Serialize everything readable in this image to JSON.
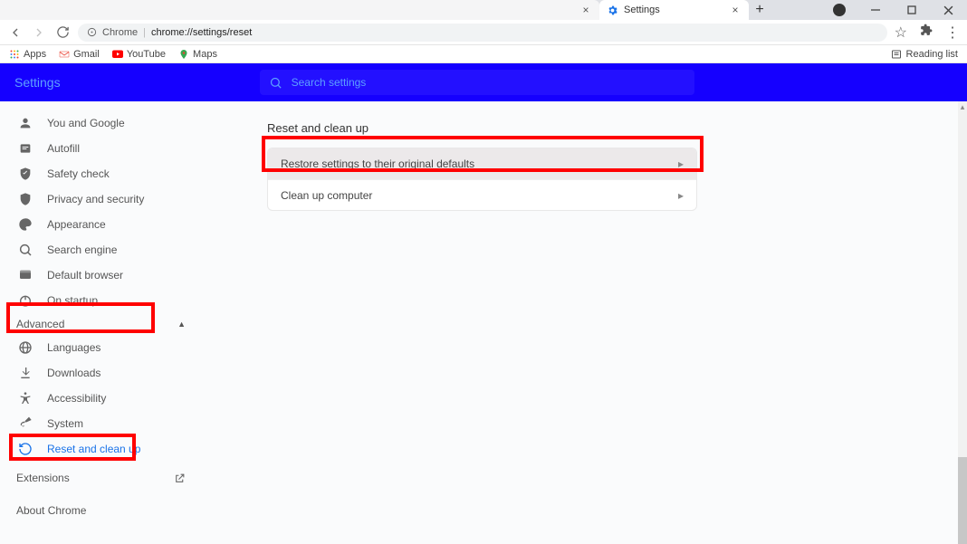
{
  "tabs": {
    "blank": {
      "close": "×"
    },
    "settings": {
      "label": "Settings",
      "close": "×"
    },
    "new": "+"
  },
  "toolbar": {
    "chrome_label": "Chrome",
    "addr_path": "chrome://settings/reset"
  },
  "bookmarks": {
    "apps": "Apps",
    "gmail": "Gmail",
    "youtube": "YouTube",
    "maps": "Maps",
    "reading": "Reading list"
  },
  "header": {
    "title": "Settings",
    "search_placeholder": "Search settings"
  },
  "sidebar": {
    "items": [
      "You and Google",
      "Autofill",
      "Safety check",
      "Privacy and security",
      "Appearance",
      "Search engine",
      "Default browser",
      "On startup"
    ],
    "advanced": "Advanced",
    "adv_items": [
      "Languages",
      "Downloads",
      "Accessibility",
      "System",
      "Reset and clean up"
    ],
    "extensions": "Extensions",
    "about": "About Chrome"
  },
  "main": {
    "section_title": "Reset and clean up",
    "rows": [
      "Restore settings to their original defaults",
      "Clean up computer"
    ]
  }
}
